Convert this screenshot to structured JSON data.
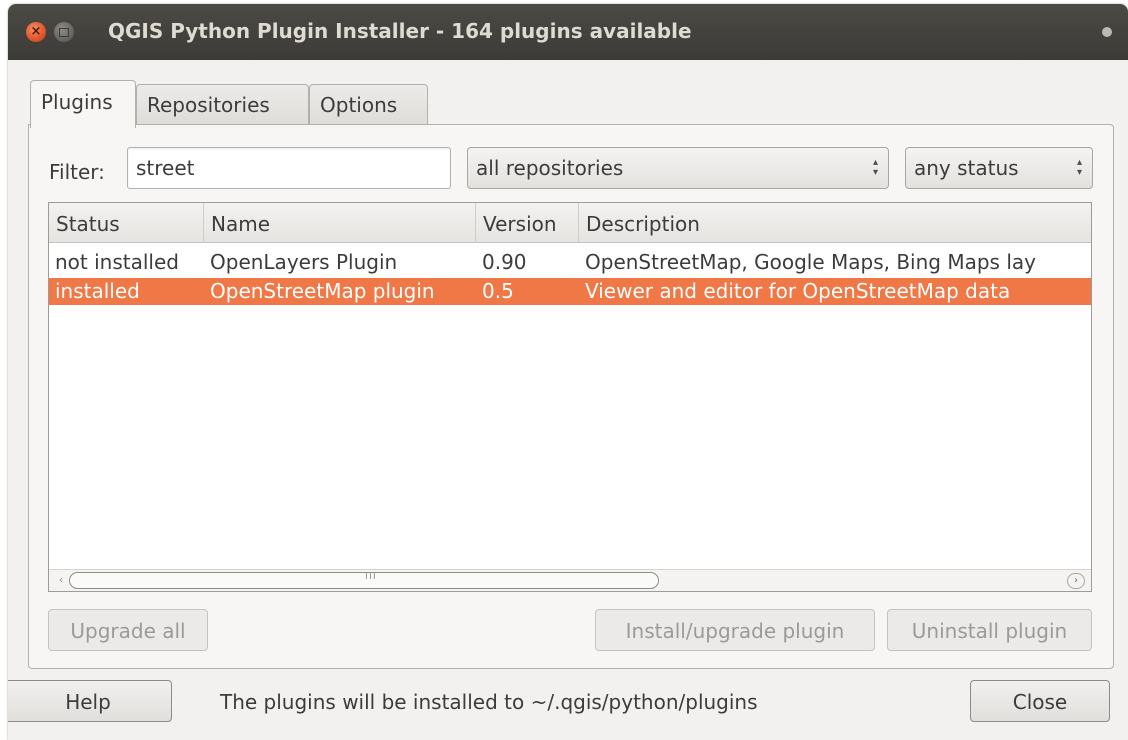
{
  "window": {
    "title": "QGIS Python Plugin Installer - 164 plugins available",
    "close_glyph": "×"
  },
  "tabs": [
    {
      "label": "Plugins",
      "active": true
    },
    {
      "label": "Repositories",
      "active": false
    },
    {
      "label": "Options",
      "active": false
    }
  ],
  "filter": {
    "label": "Filter:",
    "value": "street",
    "repository_select": "all repositories",
    "status_select": "any status"
  },
  "table": {
    "columns": [
      "Status",
      "Name",
      "Version",
      "Description"
    ],
    "rows": [
      {
        "status": "not installed",
        "name": "OpenLayers Plugin",
        "version": "0.90",
        "description": "OpenStreetMap, Google Maps, Bing Maps lay",
        "selected": false
      },
      {
        "status": "installed",
        "name": "OpenStreetMap plugin",
        "version": "0.5",
        "description": "Viewer and editor for OpenStreetMap data",
        "selected": true
      }
    ]
  },
  "buttons": {
    "upgrade_all": "Upgrade all",
    "install_upgrade": "Install/upgrade plugin",
    "uninstall": "Uninstall plugin",
    "help": "Help",
    "close": "Close"
  },
  "footer": {
    "install_path_text": "The plugins will be installed to ~/.qgis/python/plugins"
  },
  "colors": {
    "selection": "#f07746",
    "titlebar": "#3c3b37",
    "close_button": "#e2542b"
  },
  "icons": {
    "hscroll_left": "‹",
    "hscroll_right": "›",
    "select_arrows": "⌃⌄",
    "scroll_grip": "III"
  }
}
